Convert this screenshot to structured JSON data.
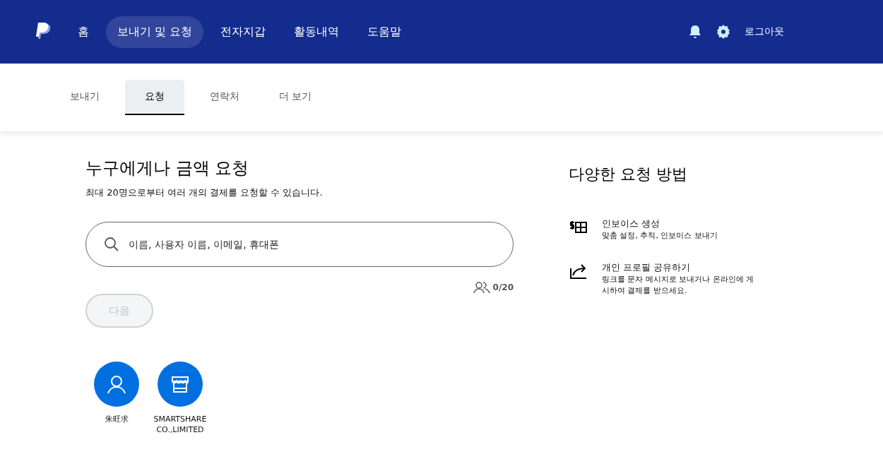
{
  "top_nav": {
    "items": [
      {
        "label": "홈",
        "selected": false
      },
      {
        "label": "보내기 및 요청",
        "selected": true
      },
      {
        "label": "전자지갑",
        "selected": false
      },
      {
        "label": "활동내역",
        "selected": false
      },
      {
        "label": "도움말",
        "selected": false
      }
    ],
    "logout": "로그아웃"
  },
  "tabs": [
    {
      "label": "보내기",
      "selected": false
    },
    {
      "label": "요청",
      "selected": true
    },
    {
      "label": "연락처",
      "selected": false
    },
    {
      "label": "더 보기",
      "selected": false
    }
  ],
  "request": {
    "title": "누구에게나 금액 요청",
    "subtitle": "최대 20명으로부터 여러 개의 결제를 요청할 수 있습니다.",
    "search": {
      "placeholder": "이름, 사용자 이름, 이메일, 휴대폰"
    },
    "count": "0/20",
    "next_button": {
      "label": "다음",
      "disabled": true
    }
  },
  "contacts": [
    {
      "kind": "person",
      "name": "朱旺求"
    },
    {
      "kind": "business",
      "name": "SMARTSHARE CO.,LIMITED"
    }
  ],
  "other_ways": {
    "title": "다양한 요청 방법",
    "items": [
      {
        "kind": "invoice",
        "title": "인보이스 생성",
        "description": "맞춤 설정, 추적, 인보이스 보내기"
      },
      {
        "kind": "share",
        "title": "개인 프로필 공유하기",
        "description": "링크를 문자 메시지로 보내거나 온라인에 게시하여 결제를 받으세요."
      }
    ]
  }
}
